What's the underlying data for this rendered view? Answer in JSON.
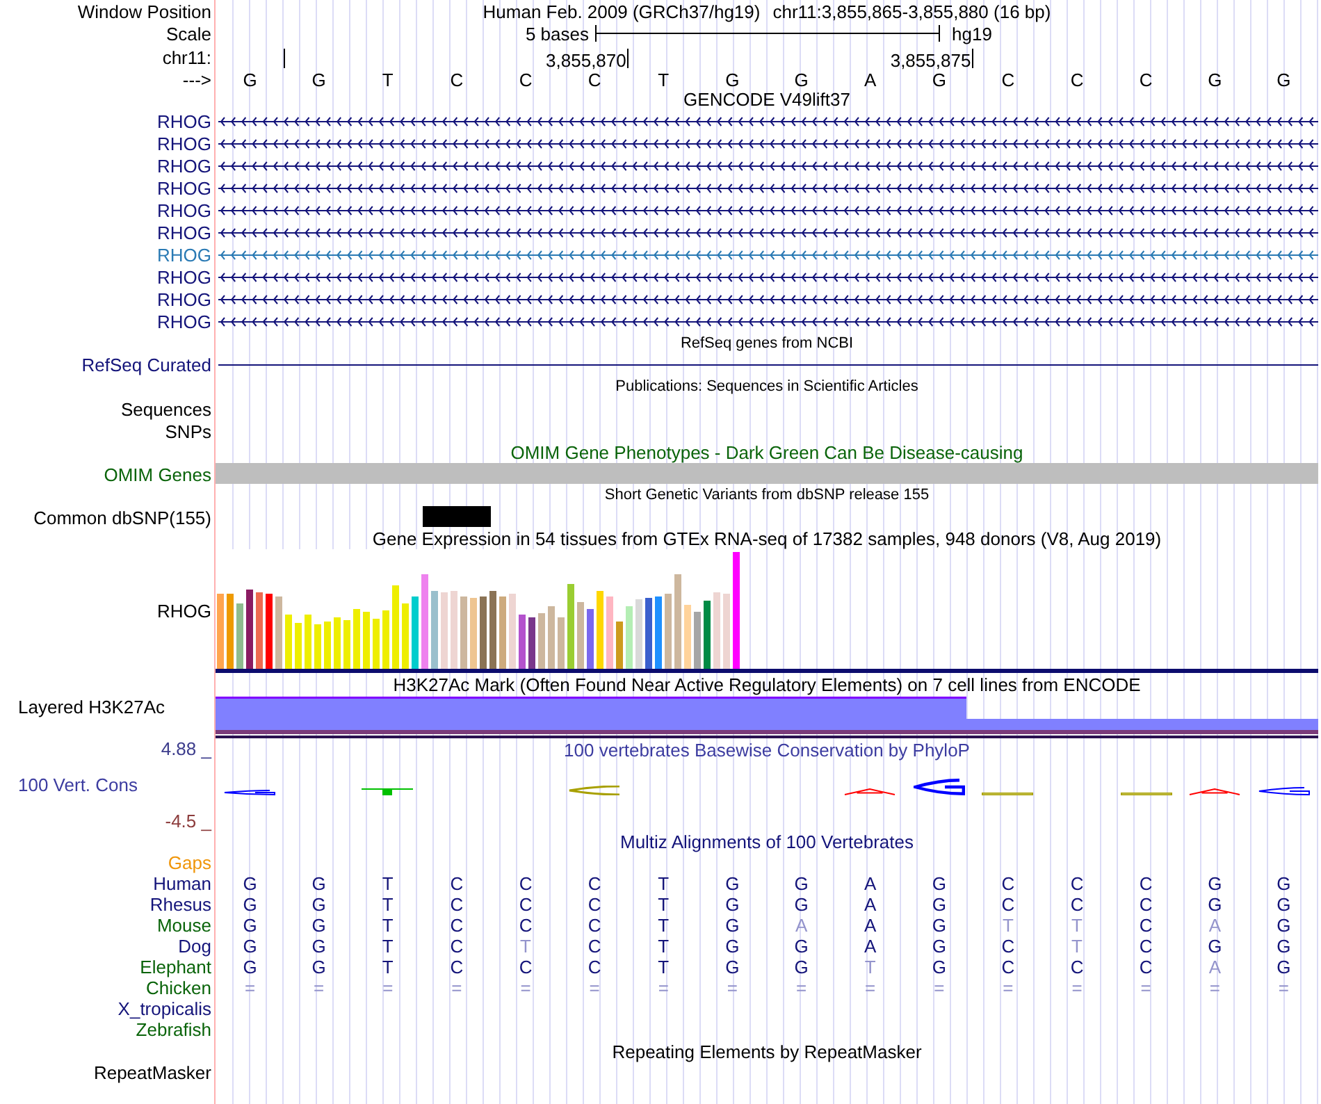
{
  "header": {
    "label": "Window Position",
    "assembly": "Human Feb. 2009 (GRCh37/hg19)",
    "position": "chr11:3,855,865-3,855,880 (16 bp)"
  },
  "scale": {
    "label": "Scale",
    "span": "5 bases",
    "assembly": "hg19"
  },
  "ruler": {
    "label": "chr11:",
    "ticks": [
      {
        "kind": "bare"
      },
      {
        "kind": "labeled",
        "label": "3,855,870"
      },
      {
        "kind": "labeled",
        "label": "3,855,875"
      }
    ]
  },
  "sequence": {
    "label": "--->",
    "bases": [
      "G",
      "G",
      "T",
      "C",
      "C",
      "C",
      "T",
      "G",
      "G",
      "A",
      "G",
      "C",
      "C",
      "C",
      "G",
      "G"
    ]
  },
  "tracks": [
    {
      "kind": "genes",
      "title": "GENCODE V49lift37",
      "color": "#000000",
      "rows": [
        {
          "label": "RHOG",
          "color": "#14147a",
          "reverse": true
        },
        {
          "label": "RHOG",
          "color": "#14147a",
          "reverse": true
        },
        {
          "label": "RHOG",
          "color": "#14147a",
          "reverse": true
        },
        {
          "label": "RHOG",
          "color": "#14147a",
          "reverse": true
        },
        {
          "label": "RHOG",
          "color": "#14147a",
          "reverse": true
        },
        {
          "label": "RHOG",
          "color": "#14147a",
          "reverse": true
        },
        {
          "label": "RHOG",
          "color": "#2a7ab4",
          "reverse": true
        },
        {
          "label": "RHOG",
          "color": "#14147a",
          "reverse": true
        },
        {
          "label": "RHOG",
          "color": "#14147a",
          "reverse": true
        },
        {
          "label": "RHOG",
          "color": "#14147a",
          "reverse": true
        }
      ]
    },
    {
      "kind": "dense",
      "title": "RefSeq genes from NCBI",
      "color": "#000000",
      "rows": [
        {
          "label": "RefSeq Curated",
          "color": "#14147a"
        }
      ]
    },
    {
      "kind": "publications",
      "title": "Publications: Sequences in Scientific Articles",
      "color": "#000000",
      "rows": [
        {
          "label": "Sequences",
          "color": "#000000"
        },
        {
          "label": "SNPs",
          "color": "#000000"
        }
      ]
    },
    {
      "kind": "omim",
      "title": "OMIM Gene Phenotypes - Dark Green Can Be Disease-causing",
      "color": "#0a640a",
      "rows": [
        {
          "label": "OMIM Genes",
          "color": "#0a640a"
        }
      ]
    },
    {
      "kind": "variants",
      "title": "Short Genetic Variants from dbSNP release 155",
      "color": "#000000",
      "rows": [
        {
          "label": "Common dbSNP(155)",
          "color": "#000000",
          "sites": [
            {
              "variant": false
            },
            {
              "variant": false
            },
            {
              "variant": false
            },
            {
              "variant": true
            },
            {
              "variant": false
            },
            {
              "variant": false
            },
            {
              "variant": false
            },
            {
              "variant": false
            },
            {
              "variant": false
            },
            {
              "variant": false
            },
            {
              "variant": false
            },
            {
              "variant": false
            },
            {
              "variant": false
            },
            {
              "variant": false
            },
            {
              "variant": false
            },
            {
              "variant": false
            }
          ]
        }
      ]
    },
    {
      "kind": "expression",
      "title": "Gene Expression in 54 tissues from GTEx RNA-seq of 17382 samples, 948 donors (V8, Aug 2019)",
      "color": "#000000",
      "rows": [
        {
          "label": "RHOG",
          "color": "#000000"
        }
      ]
    },
    {
      "kind": "layered",
      "title": "H3K27Ac Mark (Often Found Near Active Regulatory Elements) on 7 cell lines from ENCODE",
      "color": "#000000",
      "rows": [
        {
          "label": "Layered H3K27Ac",
          "color": "#000000"
        }
      ]
    },
    {
      "kind": "conservation",
      "title": "100 vertebrates Basewise Conservation by PhyloP",
      "color": "#3c3ca0",
      "rows": [
        {
          "kind": "axis",
          "label": "4.88 _",
          "color": "#3c3c8c"
        },
        {
          "kind": "name",
          "label": "100 Vert. Cons",
          "color": "#3c3ca0"
        },
        {
          "kind": "axis",
          "label": "-4.5 _",
          "color": "#8c3c3c"
        }
      ]
    },
    {
      "kind": "alignment",
      "title": "Multiz Alignments of 100 Vertebrates",
      "color": "#14147a",
      "rows": [
        {
          "label": "Gaps",
          "color": "#f0960a"
        },
        {
          "label": "Human",
          "color": "#14147a",
          "bases": [
            {
              "base": "G",
              "faded": false
            },
            {
              "base": "G",
              "faded": false
            },
            {
              "base": "T",
              "faded": false
            },
            {
              "base": "C",
              "faded": false
            },
            {
              "base": "C",
              "faded": false
            },
            {
              "base": "C",
              "faded": false
            },
            {
              "base": "T",
              "faded": false
            },
            {
              "base": "G",
              "faded": false
            },
            {
              "base": "G",
              "faded": false
            },
            {
              "base": "A",
              "faded": false
            },
            {
              "base": "G",
              "faded": false
            },
            {
              "base": "C",
              "faded": false
            },
            {
              "base": "C",
              "faded": false
            },
            {
              "base": "C",
              "faded": false
            },
            {
              "base": "G",
              "faded": false
            },
            {
              "base": "G",
              "faded": false
            }
          ]
        },
        {
          "label": "Rhesus",
          "color": "#14147a",
          "bases": [
            {
              "base": "G",
              "faded": false
            },
            {
              "base": "G",
              "faded": false
            },
            {
              "base": "T",
              "faded": false
            },
            {
              "base": "C",
              "faded": false
            },
            {
              "base": "C",
              "faded": false
            },
            {
              "base": "C",
              "faded": false
            },
            {
              "base": "T",
              "faded": false
            },
            {
              "base": "G",
              "faded": false
            },
            {
              "base": "G",
              "faded": false
            },
            {
              "base": "A",
              "faded": false
            },
            {
              "base": "G",
              "faded": false
            },
            {
              "base": "C",
              "faded": false
            },
            {
              "base": "C",
              "faded": false
            },
            {
              "base": "C",
              "faded": false
            },
            {
              "base": "G",
              "faded": false
            },
            {
              "base": "G",
              "faded": false
            }
          ]
        },
        {
          "label": "Mouse",
          "color": "#0a640a",
          "bases": [
            {
              "base": "G",
              "faded": false
            },
            {
              "base": "G",
              "faded": false
            },
            {
              "base": "T",
              "faded": false
            },
            {
              "base": "C",
              "faded": false
            },
            {
              "base": "C",
              "faded": false
            },
            {
              "base": "C",
              "faded": false
            },
            {
              "base": "T",
              "faded": false
            },
            {
              "base": "G",
              "faded": false
            },
            {
              "base": "A",
              "faded": true
            },
            {
              "base": "A",
              "faded": false
            },
            {
              "base": "G",
              "faded": false
            },
            {
              "base": "T",
              "faded": true
            },
            {
              "base": "T",
              "faded": true
            },
            {
              "base": "C",
              "faded": false
            },
            {
              "base": "A",
              "faded": true
            },
            {
              "base": "G",
              "faded": false
            }
          ]
        },
        {
          "label": "Dog",
          "color": "#14147a",
          "bases": [
            {
              "base": "G",
              "faded": false
            },
            {
              "base": "G",
              "faded": false
            },
            {
              "base": "T",
              "faded": false
            },
            {
              "base": "C",
              "faded": false
            },
            {
              "base": "T",
              "faded": true
            },
            {
              "base": "C",
              "faded": false
            },
            {
              "base": "T",
              "faded": false
            },
            {
              "base": "G",
              "faded": false
            },
            {
              "base": "G",
              "faded": false
            },
            {
              "base": "A",
              "faded": false
            },
            {
              "base": "G",
              "faded": false
            },
            {
              "base": "C",
              "faded": false
            },
            {
              "base": "T",
              "faded": true
            },
            {
              "base": "C",
              "faded": false
            },
            {
              "base": "G",
              "faded": false
            },
            {
              "base": "G",
              "faded": false
            }
          ]
        },
        {
          "label": "Elephant",
          "color": "#0a640a",
          "bases": [
            {
              "base": "G",
              "faded": false
            },
            {
              "base": "G",
              "faded": false
            },
            {
              "base": "T",
              "faded": false
            },
            {
              "base": "C",
              "faded": false
            },
            {
              "base": "C",
              "faded": false
            },
            {
              "base": "C",
              "faded": false
            },
            {
              "base": "T",
              "faded": false
            },
            {
              "base": "G",
              "faded": false
            },
            {
              "base": "G",
              "faded": false
            },
            {
              "base": "T",
              "faded": true
            },
            {
              "base": "G",
              "faded": false
            },
            {
              "base": "C",
              "faded": false
            },
            {
              "base": "C",
              "faded": false
            },
            {
              "base": "C",
              "faded": false
            },
            {
              "base": "A",
              "faded": true
            },
            {
              "base": "G",
              "faded": false
            }
          ]
        },
        {
          "label": "Chicken",
          "color": "#0a640a",
          "bases": [
            {
              "base": "=",
              "faded": true
            },
            {
              "base": "=",
              "faded": true
            },
            {
              "base": "=",
              "faded": true
            },
            {
              "base": "=",
              "faded": true
            },
            {
              "base": "=",
              "faded": true
            },
            {
              "base": "=",
              "faded": true
            },
            {
              "base": "=",
              "faded": true
            },
            {
              "base": "=",
              "faded": true
            },
            {
              "base": "=",
              "faded": true
            },
            {
              "base": "=",
              "faded": true
            },
            {
              "base": "=",
              "faded": true
            },
            {
              "base": "=",
              "faded": true
            },
            {
              "base": "=",
              "faded": true
            },
            {
              "base": "=",
              "faded": true
            },
            {
              "base": "=",
              "faded": true
            },
            {
              "base": "=",
              "faded": true
            }
          ]
        },
        {
          "label": "X_tropicalis",
          "color": "#14147a"
        },
        {
          "label": "Zebrafish",
          "color": "#0a640a"
        }
      ]
    },
    {
      "kind": "repeats",
      "title": "Repeating Elements by RepeatMasker",
      "color": "#000000",
      "rows": [
        {
          "label": "RepeatMasker",
          "color": "#000000"
        }
      ]
    }
  ]
}
